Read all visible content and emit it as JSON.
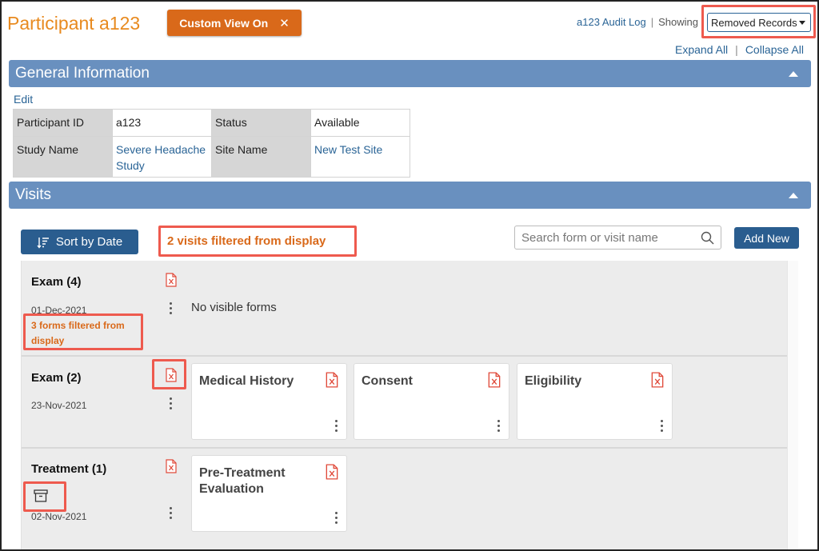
{
  "header": {
    "title": "Participant a123",
    "custom_view_label": "Custom View On",
    "custom_view_close": "✕",
    "audit_log_label": "a123 Audit Log",
    "separator": "|",
    "showing_label": "Showing",
    "showing_selected": "Removed Records",
    "expand_all": "Expand All",
    "collapse_all": "Collapse All"
  },
  "general": {
    "section_title": "General Information",
    "edit_label": "Edit",
    "rows": [
      {
        "label1": "Participant ID",
        "value1": "a123",
        "label2": "Status",
        "value2": "Available"
      },
      {
        "label1": "Study Name",
        "value1": "Severe Headache Study",
        "label2": "Site Name",
        "value2": "New Test Site"
      }
    ]
  },
  "visits": {
    "section_title": "Visits",
    "sort_label": "Sort by Date",
    "filter_note": "2 visits filtered from display",
    "search_placeholder": "Search form or visit name",
    "add_new_label": "Add New",
    "items": [
      {
        "name": "Exam (4)",
        "date": "01-Dec-2021",
        "filtered_note": "3 forms filtered from display",
        "empty_text": "No visible forms",
        "forms": []
      },
      {
        "name": "Exam (2)",
        "date": "23-Nov-2021",
        "forms": [
          "Medical History",
          "Consent",
          "Eligibility"
        ]
      },
      {
        "name": "Treatment (1)",
        "date": "02-Nov-2021",
        "forms": [
          "Pre-Treatment Evaluation"
        ]
      }
    ]
  },
  "colors": {
    "accent_orange": "#d9691a",
    "title_orange": "#e88a1f",
    "section_blue": "#6990bf",
    "button_blue": "#2a5d8f",
    "link_blue": "#2a6496",
    "highlight_red": "#ee5a4e"
  }
}
